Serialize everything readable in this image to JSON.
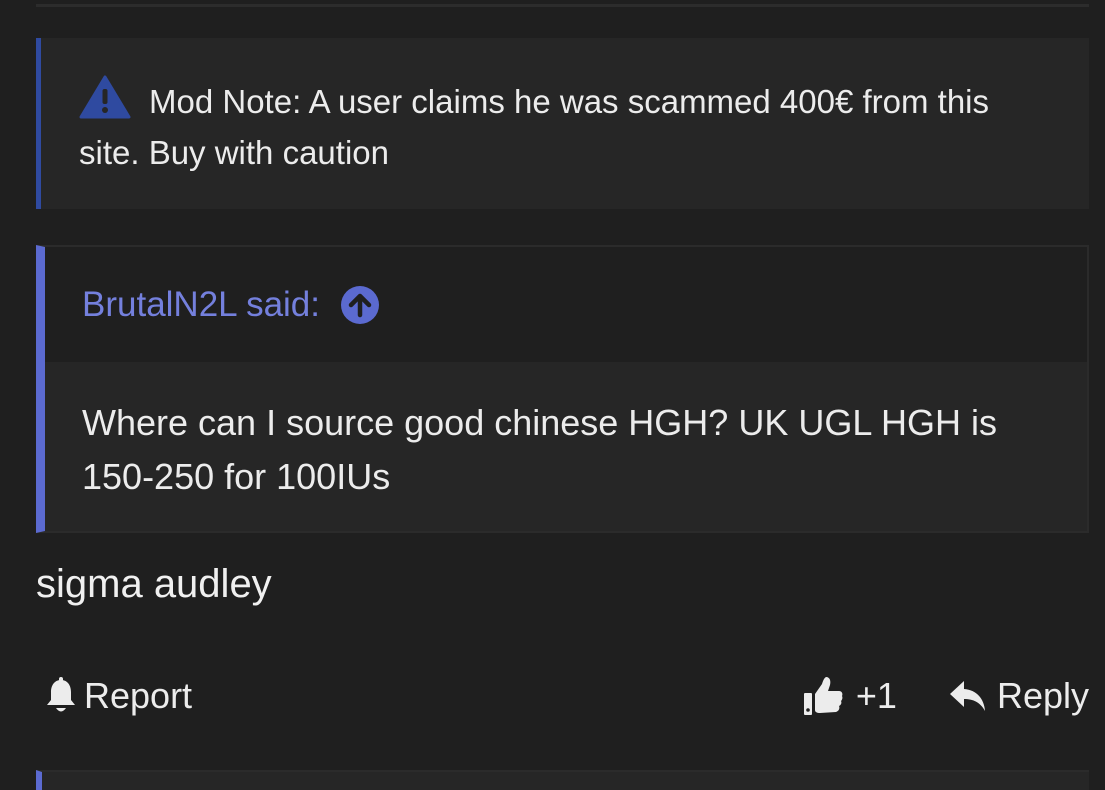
{
  "mod_note": {
    "icon": "warning-icon",
    "text": "Mod Note: A user claims he was scammed 400€ from this site. Buy with caution"
  },
  "quote": {
    "author_line": "BrutalN2L said:",
    "jump_icon": "arrow-up-circle-icon",
    "body": "Where can I source good chinese HGH? UK UGL HGH is 150-250 for 100IUs"
  },
  "post": {
    "text": "sigma audley"
  },
  "actions": {
    "report_label": "Report",
    "like_count": "+1",
    "reply_label": "Reply"
  },
  "colors": {
    "background": "#1f1f1f",
    "accent": "#5b6ad0",
    "mod_note_accent": "#2f4aa0"
  }
}
